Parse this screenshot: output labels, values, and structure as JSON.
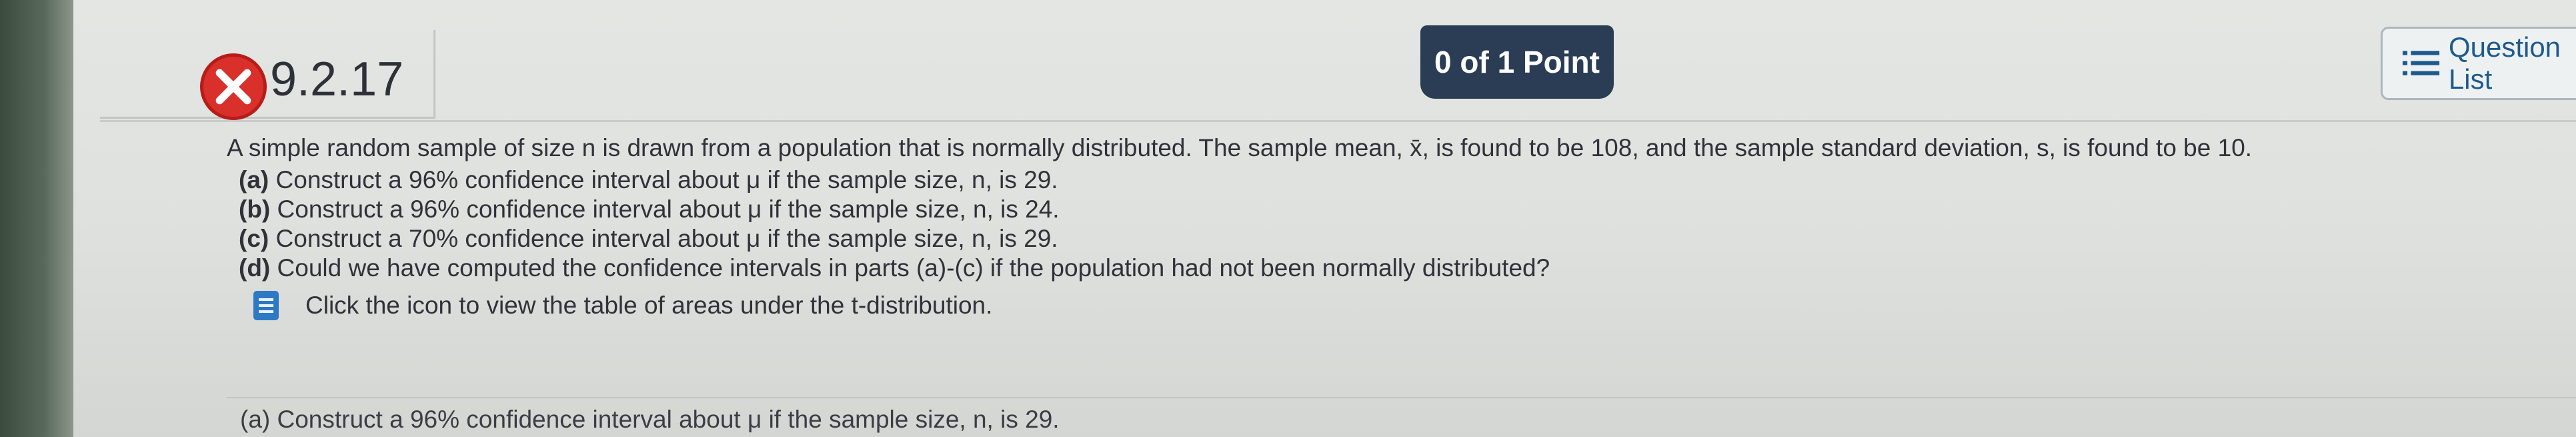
{
  "question": {
    "number": "9.2.17",
    "status": "incorrect",
    "score": "0 of 1 Point",
    "list_button": "Question List"
  },
  "problem": {
    "intro": "A simple random sample of size n is drawn from a population that is normally distributed. The sample mean, x̄, is found to be 108, and the sample standard deviation, s, is found to be 10.",
    "parts": [
      {
        "label": "(a)",
        "text": "Construct a 96% confidence interval about μ if the sample size, n, is 29."
      },
      {
        "label": "(b)",
        "text": "Construct a 96% confidence interval about μ if the sample size, n, is 24."
      },
      {
        "label": "(c)",
        "text": "Construct a 70% confidence interval about μ if the sample size, n, is 29."
      },
      {
        "label": "(d)",
        "text": "Could we have computed the confidence intervals in parts (a)-(c) if the population had not been normally distributed?"
      }
    ],
    "table_link": "Click the icon to view the table of areas under the t-distribution."
  },
  "answer_area": {
    "partial_text": "(a) Construct a 96% confidence interval about μ if the sample size, n, is 29."
  },
  "colors": {
    "incorrect_red": "#d9302b",
    "score_pill": "#2a3d55",
    "link_blue": "#1d5a8c",
    "doc_icon": "#2e79c3"
  },
  "icons": [
    "x-mark-icon",
    "list-icon",
    "document-icon"
  ]
}
